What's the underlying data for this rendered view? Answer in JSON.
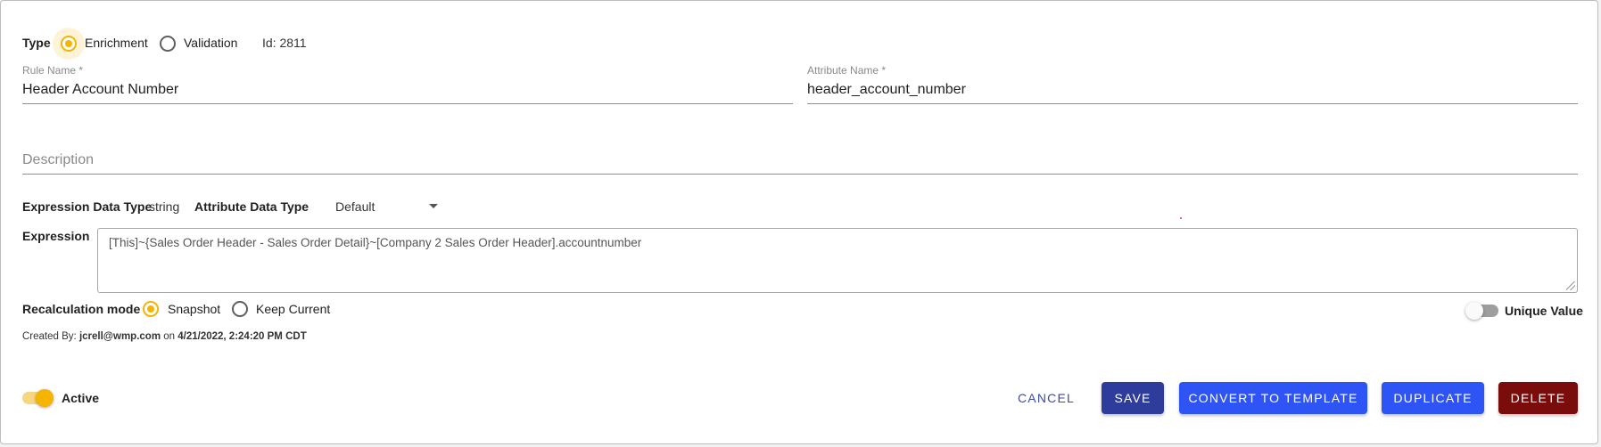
{
  "type_row": {
    "label": "Type",
    "options": [
      "Enrichment",
      "Validation"
    ],
    "selected": "Enrichment",
    "id_text": "Id: 2811"
  },
  "rule_name": {
    "label": "Rule Name *",
    "value": "Header Account Number"
  },
  "attribute_name": {
    "label": "Attribute Name *",
    "value": "header_account_number"
  },
  "description": {
    "placeholder": "Description",
    "value": ""
  },
  "data_types": {
    "expression_label": "Expression Data Type",
    "expression_value": "string",
    "attribute_label": "Attribute Data Type",
    "attribute_selected": "Default"
  },
  "expression": {
    "label": "Expression",
    "value": "[This]~{Sales Order Header - Sales Order Detail}~[Company 2 Sales Order Header].accountnumber"
  },
  "recalculation": {
    "label": "Recalculation mode",
    "options": [
      "Snapshot",
      "Keep Current"
    ],
    "selected": "Snapshot"
  },
  "unique_value": {
    "label": "Unique Value",
    "on": false
  },
  "created": {
    "prefix": "Created By:",
    "user": "jcrell@wmp.com",
    "on_text": "on",
    "timestamp": "4/21/2022, 2:24:20 PM CDT"
  },
  "active": {
    "label": "Active",
    "on": true
  },
  "actions": {
    "cancel": "CANCEL",
    "save": "SAVE",
    "convert": "CONVERT TO TEMPLATE",
    "duplicate": "DUPLICATE",
    "delete": "DELETE"
  },
  "colors": {
    "accent": "#f4b400",
    "save_bg": "#2e3d9c",
    "primary_bg": "#2f54f5",
    "delete_bg": "#7b0c0c",
    "cancel_text": "#3b4aa8"
  }
}
